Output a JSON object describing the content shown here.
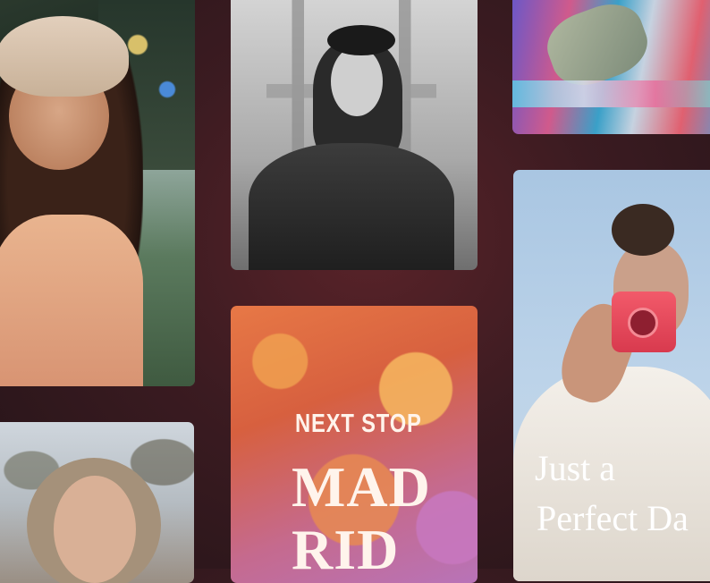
{
  "cards": {
    "madrid": {
      "eyebrow": "NEXT STOP",
      "title_line1": "MAD",
      "title_line2": "RID"
    },
    "camera": {
      "caption_line1": "Just a",
      "caption_line2": "Perfect Da"
    }
  },
  "colors": {
    "background": "#3b1b21",
    "text_overlay": "#fff4ec"
  }
}
